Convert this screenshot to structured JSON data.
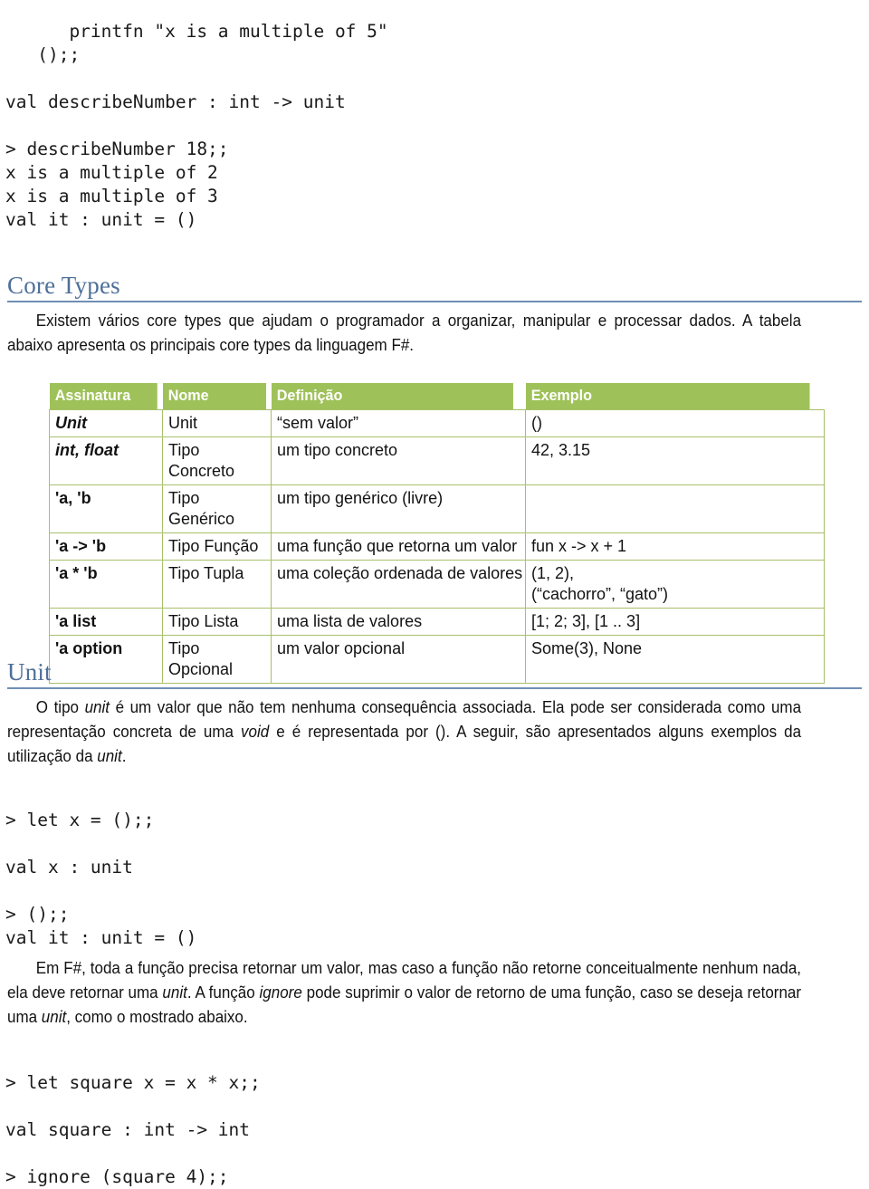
{
  "document": {
    "language": "pt-BR",
    "topic": "F# Core Types e Unit"
  },
  "code_top": {
    "lines": "      printfn \"x is a multiple of 5\"\n   ();;\n\nval describeNumber : int -> unit\n\n> describeNumber 18;;\nx is a multiple of 2\nx is a multiple of 3\nval it : unit = ()"
  },
  "section_core_types": {
    "heading": "Core Types",
    "paragraph_pre": "Existem vários core types que ajudam o programador a organizar, manipular e processar dados. A tabela abaixo apresenta os principais core types da linguagem F#."
  },
  "table": {
    "columns": [
      "Assinatura",
      "Nome",
      "Definição",
      "Exemplo"
    ],
    "rows": [
      {
        "assinatura": "Unit",
        "assinatura_style": "bold-italic",
        "nome": "Unit",
        "definicao": "“sem valor”",
        "exemplo": "()"
      },
      {
        "assinatura": "int, float",
        "assinatura_style": "bold-italic",
        "nome": "Tipo Concreto",
        "definicao": "um tipo concreto",
        "exemplo": "42, 3.15"
      },
      {
        "assinatura": "'a, 'b",
        "assinatura_style": "bold",
        "nome": "Tipo Genérico",
        "definicao": "um tipo genérico (livre)",
        "exemplo": ""
      },
      {
        "assinatura": "'a -> 'b",
        "assinatura_style": "bold",
        "nome": "Tipo Função",
        "definicao": "uma função que retorna um valor",
        "exemplo": "fun x -> x + 1"
      },
      {
        "assinatura": "'a * 'b",
        "assinatura_style": "bold",
        "nome": "Tipo Tupla",
        "definicao": "uma coleção ordenada de valores",
        "exemplo": "(1, 2),\n(“cachorro”, “gato”)"
      },
      {
        "assinatura": "'a list",
        "assinatura_style": "bold",
        "nome": "Tipo Lista",
        "definicao": "uma lista de valores",
        "exemplo": "[1; 2; 3], [1 .. 3]"
      },
      {
        "assinatura": "'a option",
        "assinatura_style": "bold",
        "nome": "Tipo Opcional",
        "definicao": "um valor opcional",
        "exemplo": "Some(3), None"
      }
    ]
  },
  "section_unit": {
    "heading": "Unit",
    "paragraph_1_a": "O tipo ",
    "paragraph_1_em1": "unit",
    "paragraph_1_b": " é um valor que não tem nenhuma consequência associada. Ela pode ser considerada como uma representação concreta de uma ",
    "paragraph_1_em2": "void",
    "paragraph_1_c": " e é representada por (). A seguir, são apresentados alguns exemplos da utilização da ",
    "paragraph_1_em3": "unit",
    "paragraph_1_d": ".",
    "code_1": "> let x = ();;\n\nval x : unit\n\n> ();;\nval it : unit = ()",
    "paragraph_2_a": "Em F#, toda a função precisa retornar um valor, mas caso a função não retorne conceitualmente nenhum nada, ela deve retornar uma ",
    "paragraph_2_em1": "unit",
    "paragraph_2_b": ". A função ",
    "paragraph_2_em2": "ignore",
    "paragraph_2_c": " pode suprimir o valor de retorno de uma função, caso se deseja retornar uma ",
    "paragraph_2_em3": "unit",
    "paragraph_2_d": ", como o mostrado abaixo.",
    "code_2": "> let square x = x * x;;\n\nval square : int -> int\n\n> ignore (square 4);;"
  },
  "colors": {
    "heading": "#4e6f98",
    "heading_rule": "#6f8fb5",
    "table_header_bg": "#9fc159",
    "table_header_text": "#ffffff",
    "table_border": "#a7c06a",
    "body_text": "#121212"
  }
}
